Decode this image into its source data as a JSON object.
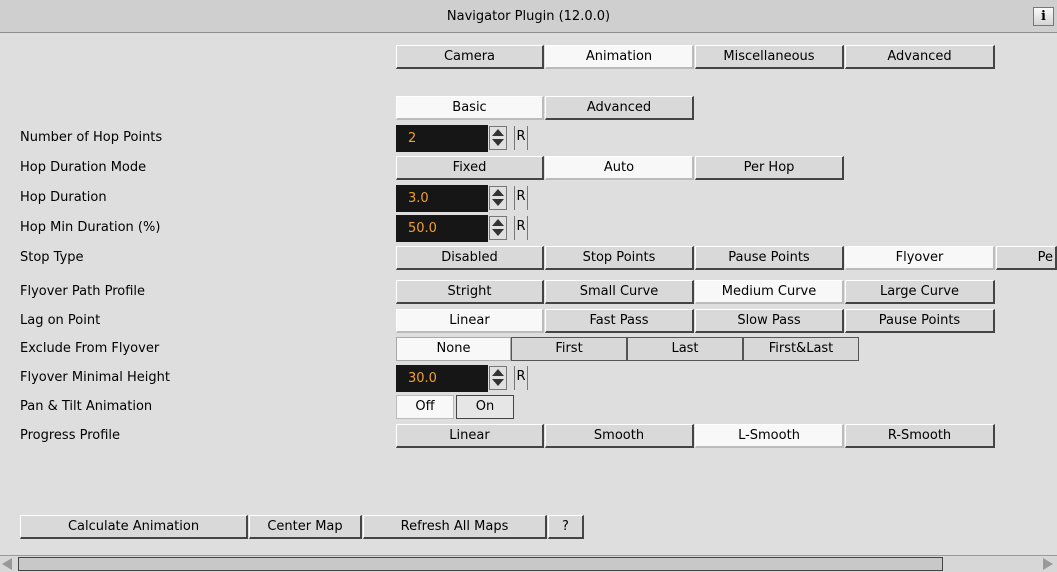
{
  "window": {
    "title": "Navigator Plugin (12.0.0)",
    "info_button": "i"
  },
  "main_tabs": [
    "Camera",
    "Animation",
    "Miscellaneous",
    "Advanced"
  ],
  "main_tabs_selected": "Animation",
  "sub_tabs": [
    "Basic",
    "Advanced"
  ],
  "sub_tabs_selected": "Basic",
  "labels": {
    "hop_points": "Number of Hop Points",
    "hop_duration_mode": "Hop Duration Mode",
    "hop_duration": "Hop Duration",
    "hop_min_duration": "Hop Min Duration (%)",
    "stop_type": "Stop Type",
    "flyover_path_profile": "Flyover Path Profile",
    "lag_on_point": "Lag on Point",
    "exclude_from_flyover": "Exclude From Flyover",
    "flyover_minimal_height": "Flyover Minimal Height",
    "pan_tilt_animation": "Pan & Tilt Animation",
    "progress_profile": "Progress Profile"
  },
  "values": {
    "hop_points": "2",
    "hop_duration": "3.0",
    "hop_min_duration": "50.0",
    "flyover_minimal_height": "30.0"
  },
  "reset_label": "R",
  "hop_duration_mode": {
    "options": [
      "Fixed",
      "Auto",
      "Per Hop"
    ],
    "selected": "Auto"
  },
  "stop_type": {
    "options": [
      "Disabled",
      "Stop Points",
      "Pause Points",
      "Flyover",
      "Pe"
    ],
    "selected": "Flyover"
  },
  "flyover_path_profile": {
    "options": [
      "Stright",
      "Small Curve",
      "Medium Curve",
      "Large Curve"
    ],
    "selected": "Medium Curve"
  },
  "lag_on_point": {
    "options": [
      "Linear",
      "Fast Pass",
      "Slow Pass",
      "Pause Points"
    ],
    "selected": "Linear"
  },
  "exclude_from_flyover": {
    "options": [
      "None",
      "First",
      "Last",
      "First&Last"
    ],
    "selected": "None"
  },
  "pan_tilt_animation": {
    "options": [
      "Off",
      "On"
    ],
    "selected": "Off"
  },
  "progress_profile": {
    "options": [
      "Linear",
      "Smooth",
      "L-Smooth",
      "R-Smooth"
    ],
    "selected": "L-Smooth"
  },
  "footer_buttons": [
    "Calculate  Animation",
    "Center Map",
    "Refresh All Maps",
    "?"
  ],
  "icons": {
    "spinner": "up-down-arrows-icon",
    "scroll_left": "scroll-left-arrow-icon",
    "scroll_right": "scroll-right-arrow-icon"
  }
}
